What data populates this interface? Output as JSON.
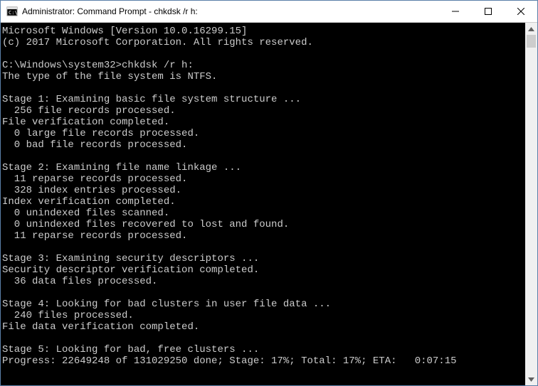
{
  "window": {
    "title": "Administrator: Command Prompt - chkdsk  /r h:"
  },
  "console": {
    "lines": [
      "Microsoft Windows [Version 10.0.16299.15]",
      "(c) 2017 Microsoft Corporation. All rights reserved.",
      "",
      "C:\\Windows\\system32>chkdsk /r h:",
      "The type of the file system is NTFS.",
      "",
      "Stage 1: Examining basic file system structure ...",
      "  256 file records processed.",
      "File verification completed.",
      "  0 large file records processed.",
      "  0 bad file records processed.",
      "",
      "Stage 2: Examining file name linkage ...",
      "  11 reparse records processed.",
      "  328 index entries processed.",
      "Index verification completed.",
      "  0 unindexed files scanned.",
      "  0 unindexed files recovered to lost and found.",
      "  11 reparse records processed.",
      "",
      "Stage 3: Examining security descriptors ...",
      "Security descriptor verification completed.",
      "  36 data files processed.",
      "",
      "Stage 4: Looking for bad clusters in user file data ...",
      "  240 files processed.",
      "File data verification completed.",
      "",
      "Stage 5: Looking for bad, free clusters ...",
      "Progress: 22649248 of 131029250 done; Stage: 17%; Total: 17%; ETA:   0:07:15"
    ]
  }
}
